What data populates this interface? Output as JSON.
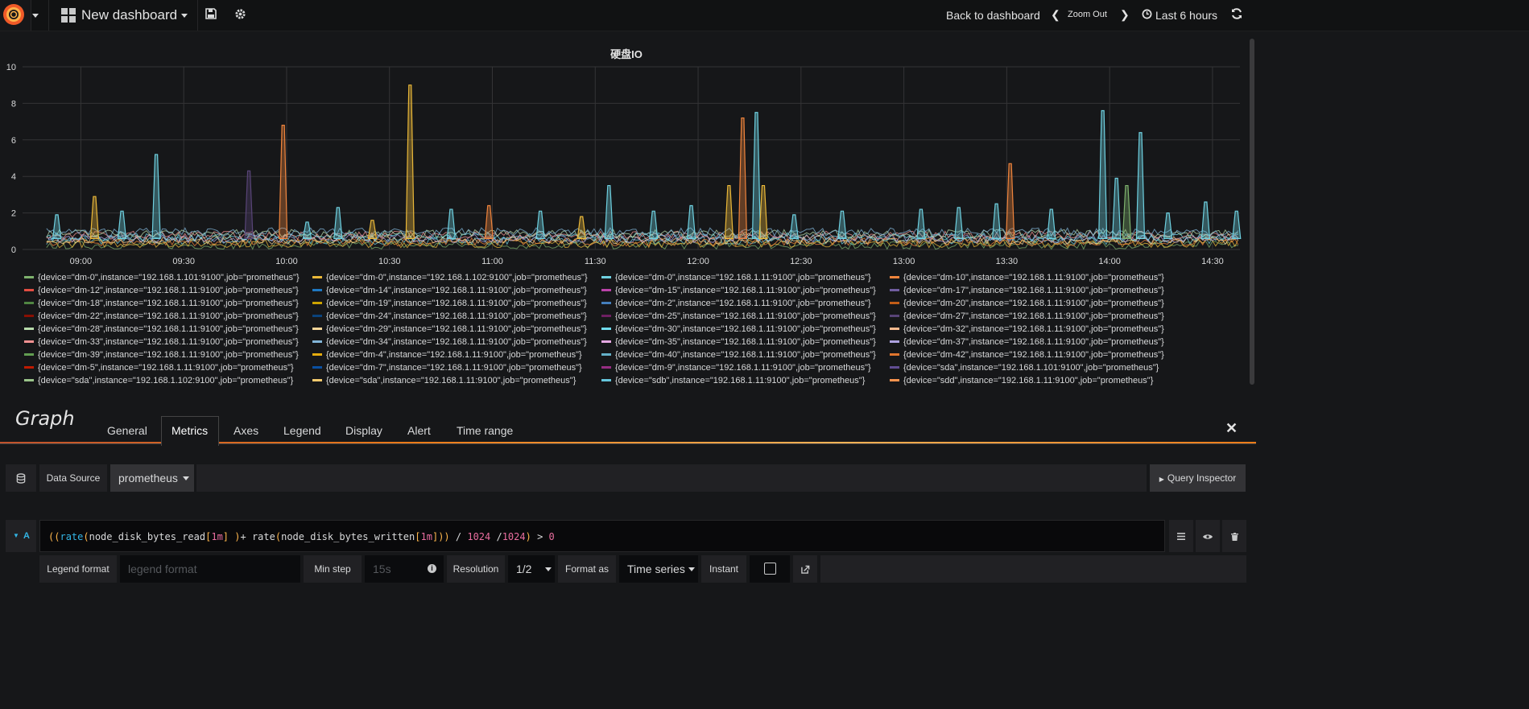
{
  "topbar": {
    "dashboard_title": "New dashboard",
    "back_label": "Back to dashboard",
    "zoom_out_label": "Zoom Out",
    "time_range_label": "Last 6 hours"
  },
  "panel": {
    "title": "硬盘IO"
  },
  "chart_data": {
    "type": "line",
    "title": "硬盘IO",
    "xlabel": "",
    "ylabel": "",
    "ylim": [
      0,
      10
    ],
    "y_ticks": [
      "0",
      "2",
      "4",
      "6",
      "8",
      "10"
    ],
    "x_ticks": [
      "09:00",
      "09:30",
      "10:00",
      "10:30",
      "11:00",
      "11:30",
      "12:00",
      "12:30",
      "13:00",
      "13:30",
      "14:00",
      "14:30"
    ],
    "x_range": [
      "08:43",
      "14:38"
    ],
    "grid": true,
    "legend_position": "bottom",
    "series": [
      {
        "name": "{device=\"dm-0\",instance=\"192.168.1.101:9100\",job=\"prometheus\"}",
        "color": "#7eb26d"
      },
      {
        "name": "{device=\"dm-0\",instance=\"192.168.1.102:9100\",job=\"prometheus\"}",
        "color": "#eab839"
      },
      {
        "name": "{device=\"dm-0\",instance=\"192.168.1.11:9100\",job=\"prometheus\"}",
        "color": "#6ed0e0"
      },
      {
        "name": "{device=\"dm-10\",instance=\"192.168.1.11:9100\",job=\"prometheus\"}",
        "color": "#ef843c"
      },
      {
        "name": "{device=\"dm-12\",instance=\"192.168.1.11:9100\",job=\"prometheus\"}",
        "color": "#e24d42"
      },
      {
        "name": "{device=\"dm-14\",instance=\"192.168.1.11:9100\",job=\"prometheus\"}",
        "color": "#1f78c1"
      },
      {
        "name": "{device=\"dm-15\",instance=\"192.168.1.11:9100\",job=\"prometheus\"}",
        "color": "#ba43a9"
      },
      {
        "name": "{device=\"dm-17\",instance=\"192.168.1.11:9100\",job=\"prometheus\"}",
        "color": "#705da0"
      },
      {
        "name": "{device=\"dm-18\",instance=\"192.168.1.11:9100\",job=\"prometheus\"}",
        "color": "#508642"
      },
      {
        "name": "{device=\"dm-19\",instance=\"192.168.1.11:9100\",job=\"prometheus\"}",
        "color": "#cca300"
      },
      {
        "name": "{device=\"dm-2\",instance=\"192.168.1.11:9100\",job=\"prometheus\"}",
        "color": "#447ebc"
      },
      {
        "name": "{device=\"dm-20\",instance=\"192.168.1.11:9100\",job=\"prometheus\"}",
        "color": "#c15c17"
      },
      {
        "name": "{device=\"dm-22\",instance=\"192.168.1.11:9100\",job=\"prometheus\"}",
        "color": "#890f02"
      },
      {
        "name": "{device=\"dm-24\",instance=\"192.168.1.11:9100\",job=\"prometheus\"}",
        "color": "#0a437c"
      },
      {
        "name": "{device=\"dm-25\",instance=\"192.168.1.11:9100\",job=\"prometheus\"}",
        "color": "#6d1f62"
      },
      {
        "name": "{device=\"dm-27\",instance=\"192.168.1.11:9100\",job=\"prometheus\"}",
        "color": "#584477"
      },
      {
        "name": "{device=\"dm-28\",instance=\"192.168.1.11:9100\",job=\"prometheus\"}",
        "color": "#b7dbab"
      },
      {
        "name": "{device=\"dm-29\",instance=\"192.168.1.11:9100\",job=\"prometheus\"}",
        "color": "#f4d598"
      },
      {
        "name": "{device=\"dm-30\",instance=\"192.168.1.11:9100\",job=\"prometheus\"}",
        "color": "#70dbed"
      },
      {
        "name": "{device=\"dm-32\",instance=\"192.168.1.11:9100\",job=\"prometheus\"}",
        "color": "#f9ba8f"
      },
      {
        "name": "{device=\"dm-33\",instance=\"192.168.1.11:9100\",job=\"prometheus\"}",
        "color": "#f29191"
      },
      {
        "name": "{device=\"dm-34\",instance=\"192.168.1.11:9100\",job=\"prometheus\"}",
        "color": "#82b5d8"
      },
      {
        "name": "{device=\"dm-35\",instance=\"192.168.1.11:9100\",job=\"prometheus\"}",
        "color": "#e5a8e2"
      },
      {
        "name": "{device=\"dm-37\",instance=\"192.168.1.11:9100\",job=\"prometheus\"}",
        "color": "#aea2e0"
      },
      {
        "name": "{device=\"dm-39\",instance=\"192.168.1.11:9100\",job=\"prometheus\"}",
        "color": "#629e51"
      },
      {
        "name": "{device=\"dm-4\",instance=\"192.168.1.11:9100\",job=\"prometheus\"}",
        "color": "#e5ac0e"
      },
      {
        "name": "{device=\"dm-40\",instance=\"192.168.1.11:9100\",job=\"prometheus\"}",
        "color": "#64b0c8"
      },
      {
        "name": "{device=\"dm-42\",instance=\"192.168.1.11:9100\",job=\"prometheus\"}",
        "color": "#e0752d"
      },
      {
        "name": "{device=\"dm-5\",instance=\"192.168.1.11:9100\",job=\"prometheus\"}",
        "color": "#bf1b00"
      },
      {
        "name": "{device=\"dm-7\",instance=\"192.168.1.11:9100\",job=\"prometheus\"}",
        "color": "#0a50a1"
      },
      {
        "name": "{device=\"dm-9\",instance=\"192.168.1.11:9100\",job=\"prometheus\"}",
        "color": "#962d82"
      },
      {
        "name": "{device=\"sda\",instance=\"192.168.1.101:9100\",job=\"prometheus\"}",
        "color": "#614d93"
      },
      {
        "name": "{device=\"sda\",instance=\"192.168.1.102:9100\",job=\"prometheus\"}",
        "color": "#9ac48a"
      },
      {
        "name": "{device=\"sda\",instance=\"192.168.1.11:9100\",job=\"prometheus\"}",
        "color": "#f2c96d"
      },
      {
        "name": "{device=\"sdb\",instance=\"192.168.1.11:9100\",job=\"prometheus\"}",
        "color": "#65c5db"
      },
      {
        "name": "{device=\"sdd\",instance=\"192.168.1.11:9100\",job=\"prometheus\"}",
        "color": "#f9934e"
      }
    ],
    "peaks": [
      {
        "time": "08:53",
        "value": 1.9,
        "color": "#6ed0e0"
      },
      {
        "time": "09:04",
        "value": 2.9,
        "color": "#eab839"
      },
      {
        "time": "09:12",
        "value": 2.1,
        "color": "#6ed0e0"
      },
      {
        "time": "09:22",
        "value": 5.2,
        "color": "#6ed0e0"
      },
      {
        "time": "09:49",
        "value": 4.3,
        "color": "#584477"
      },
      {
        "time": "09:59",
        "value": 6.8,
        "color": "#ef843c"
      },
      {
        "time": "10:06",
        "value": 1.5,
        "color": "#6ed0e0"
      },
      {
        "time": "10:15",
        "value": 2.3,
        "color": "#6ed0e0"
      },
      {
        "time": "10:25",
        "value": 1.6,
        "color": "#eab839"
      },
      {
        "time": "10:36",
        "value": 9.0,
        "color": "#eab839"
      },
      {
        "time": "10:48",
        "value": 2.2,
        "color": "#6ed0e0"
      },
      {
        "time": "10:59",
        "value": 2.4,
        "color": "#ef843c"
      },
      {
        "time": "11:14",
        "value": 2.1,
        "color": "#6ed0e0"
      },
      {
        "time": "11:26",
        "value": 1.8,
        "color": "#eab839"
      },
      {
        "time": "11:34",
        "value": 3.5,
        "color": "#6ed0e0"
      },
      {
        "time": "11:47",
        "value": 2.1,
        "color": "#6ed0e0"
      },
      {
        "time": "11:58",
        "value": 2.4,
        "color": "#6ed0e0"
      },
      {
        "time": "12:09",
        "value": 3.5,
        "color": "#eab839"
      },
      {
        "time": "12:13",
        "value": 7.2,
        "color": "#ef843c"
      },
      {
        "time": "12:17",
        "value": 7.5,
        "color": "#6ed0e0"
      },
      {
        "time": "12:19",
        "value": 3.5,
        "color": "#eab839"
      },
      {
        "time": "12:28",
        "value": 1.9,
        "color": "#6ed0e0"
      },
      {
        "time": "12:42",
        "value": 2.1,
        "color": "#6ed0e0"
      },
      {
        "time": "13:05",
        "value": 2.2,
        "color": "#6ed0e0"
      },
      {
        "time": "13:16",
        "value": 2.3,
        "color": "#6ed0e0"
      },
      {
        "time": "13:27",
        "value": 2.5,
        "color": "#6ed0e0"
      },
      {
        "time": "13:31",
        "value": 4.7,
        "color": "#ef843c"
      },
      {
        "time": "13:43",
        "value": 2.2,
        "color": "#6ed0e0"
      },
      {
        "time": "13:58",
        "value": 7.6,
        "color": "#6ed0e0"
      },
      {
        "time": "14:02",
        "value": 3.9,
        "color": "#6ed0e0"
      },
      {
        "time": "14:05",
        "value": 3.5,
        "color": "#7eb26d"
      },
      {
        "time": "14:09",
        "value": 6.4,
        "color": "#6ed0e0"
      },
      {
        "time": "14:17",
        "value": 2.0,
        "color": "#6ed0e0"
      },
      {
        "time": "14:28",
        "value": 2.6,
        "color": "#6ed0e0"
      },
      {
        "time": "14:37",
        "value": 2.1,
        "color": "#6ed0e0"
      }
    ]
  },
  "editor": {
    "panel_type": "Graph",
    "tabs": [
      "General",
      "Metrics",
      "Axes",
      "Legend",
      "Display",
      "Alert",
      "Time range"
    ],
    "active_tab": "Metrics",
    "datasource_label": "Data Source",
    "datasource_value": "prometheus",
    "query_inspector": "Query Inspector",
    "query_ref": "A",
    "query_text": "((rate(node_disk_bytes_read[1m] )+ rate(node_disk_bytes_written[1m])) / 1024 /1024) > 0",
    "legend_format_label": "Legend format",
    "legend_format_placeholder": "legend format",
    "min_step_label": "Min step",
    "min_step_placeholder": "15s",
    "resolution_label": "Resolution",
    "resolution_value": "1/2",
    "format_as_label": "Format as",
    "format_as_value": "Time series",
    "instant_label": "Instant"
  }
}
